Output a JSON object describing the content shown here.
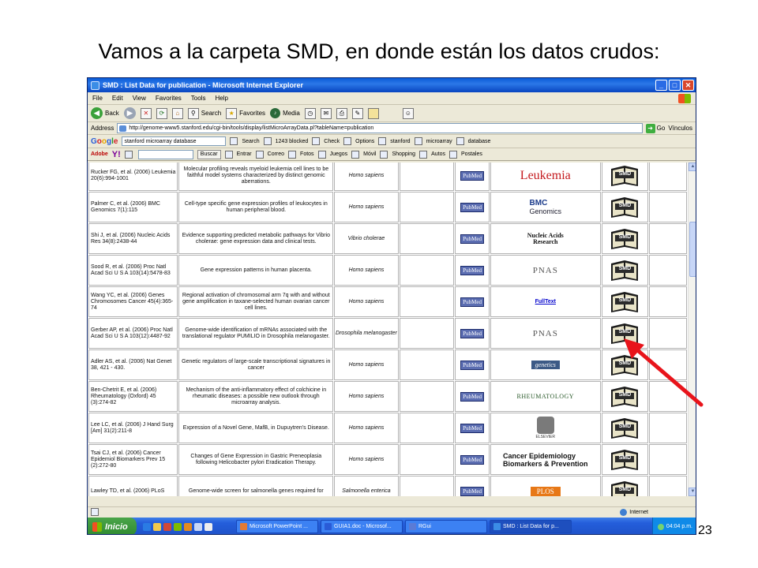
{
  "slide": {
    "title": "Vamos a la carpeta SMD, en donde están los datos crudos:",
    "number": "23"
  },
  "window": {
    "title": "SMD : List Data for publication - Microsoft Internet Explorer",
    "min": "_",
    "max": "□",
    "close": "✕"
  },
  "menu": [
    "File",
    "Edit",
    "View",
    "Favorites",
    "Tools",
    "Help"
  ],
  "toolbar": {
    "back": "Back",
    "search": "Search",
    "favorites": "Favorites",
    "media": "Media"
  },
  "address": {
    "label": "Address",
    "url": "http://genome-www5.stanford.edu/cgi-bin/tools/display/listMicroArrayData.pl?tableName=publication",
    "go": "Go",
    "links": "Vínculos"
  },
  "google": {
    "logo": "Google",
    "query": "stanford microarray database",
    "search": "Search",
    "blocked": "1243 blocked",
    "check": "Check",
    "options": "Options",
    "chips": [
      "stanford",
      "microarray",
      "database"
    ]
  },
  "yahoo": {
    "logo": "Y!",
    "adobe": "Adobe",
    "buscar": "Buscar",
    "entrar": "Entrar",
    "items": [
      "Correo",
      "Fotos",
      "Juegos",
      "Móvil",
      "Shopping",
      "Autos",
      "Postales"
    ]
  },
  "rows": [
    {
      "cite": "Rucker FG, et al. (2006) Leukemia 20(6):994-1001",
      "desc": "Molecular profiling reveals myeloid leukemia cell lines to be faithful model systems characterized by distinct genomic aberrations.",
      "org": "Homo sapiens",
      "pubmed": "PubMed",
      "journal": "Leukemia",
      "journal_style": "leukemia",
      "smd": "SMD"
    },
    {
      "cite": "Palmer C, et al. (2006) BMC Genomics 7(1):115",
      "desc": "Cell-type specific gene expression profiles of leukocytes in human peripheral blood.",
      "org": "Homo sapiens",
      "pubmed": "PubMed",
      "journal": "BMC",
      "journal2": "Genomics",
      "journal_style": "bmc",
      "smd": "SMD"
    },
    {
      "cite": "Shi J, et al. (2006) Nucleic Acids Res 34(8):2438-44",
      "desc": "Evidence supporting predicted metabolic pathways for Vibrio cholerae: gene expression data and clinical tests.",
      "org": "Vibrio cholerae",
      "pubmed": "PubMed",
      "journal": "Nucleic Acids",
      "journal2": "Research",
      "journal_style": "nar",
      "smd": "SMD"
    },
    {
      "cite": "Sood R, et al. (2006) Proc Natl Acad Sci U S A 103(14):5478-83",
      "desc": "Gene expression patterns in human placenta.",
      "org": "Homo sapiens",
      "pubmed": "PubMed",
      "journal": "PNAS",
      "journal_style": "pnas",
      "smd": "SMD"
    },
    {
      "cite": "Wang YC, et al. (2006) Genes Chromosomes Cancer 45(4):365-74",
      "desc": "Regional activation of chromosomal arm 7q with and without gene amplification in taxane-selected human ovarian cancer cell lines.",
      "org": "Homo sapiens",
      "pubmed": "PubMed",
      "journal": "FullText",
      "journal_style": "fulltext",
      "smd": "SMD"
    },
    {
      "cite": "Gerber AP, et al. (2006) Proc Natl Acad Sci U S A 103(12):4487-92",
      "desc": "Genome-wide identification of mRNAs associated with the translational regulator PUMILIO in Drosophila melanogaster.",
      "org": "Drosophila melanogaster",
      "pubmed": "PubMed",
      "journal": "PNAS",
      "journal_style": "pnas",
      "smd": "SMD"
    },
    {
      "cite": "Adler AS, et al. (2006) Nat Genet 38, 421 - 430.",
      "desc": "Genetic regulators of large-scale transcriptional signatures in cancer",
      "org": "Homo sapiens",
      "pubmed": "PubMed",
      "journal": "genetics",
      "journal_style": "genetics",
      "smd": "SMD"
    },
    {
      "cite": "Ben-Chetrit E, et al. (2006) Rheumatology (Oxford) 45 (3):274-82",
      "desc": "Mechanism of the anti-inflammatory effect of colchicine in rheumatic diseases: a possible new outlook through microarray analysis.",
      "org": "Homo sapiens",
      "pubmed": "PubMed",
      "journal": "RHEUMATOLOGY",
      "journal_style": "rheum",
      "smd": "SMD"
    },
    {
      "cite": "Lee LC, et al. (2006) J Hand Surg [Am] 31(2):211-8",
      "desc": "Expression of a Novel Gene, MafB, in Dupuytren's Disease.",
      "org": "Homo sapiens",
      "pubmed": "PubMed",
      "journal": "ELSEVIER",
      "journal_style": "elsevier",
      "smd": "SMD"
    },
    {
      "cite": "Tsai CJ, et al. (2006) Cancer Epidemiol Biomarkers Prev 15 (2):272-80",
      "desc": "Changes of Gene Expression in Gastric Preneoplasia following Helicobacter pylori Eradication Therapy.",
      "org": "Homo sapiens",
      "pubmed": "PubMed",
      "journal": "Cancer Epidemiology",
      "journal2": "Biomarkers & Prevention",
      "journal_style": "cebp",
      "smd": "SMD"
    },
    {
      "cite": "Lawley TD, et al. (2006) PLoS",
      "desc": "Genome-wide screen for salmonella genes required for",
      "org": "Salmonella enterica",
      "pubmed": "PubMed",
      "journal": "PLOS",
      "journal_style": "plos",
      "smd": "SMD"
    }
  ],
  "status": {
    "zone": "Internet"
  },
  "taskbar": {
    "start": "Inicio",
    "tasks": [
      "Microsoft PowerPoint ...",
      "GUIA1.doc - Microsof...",
      "RGui",
      "SMD : List Data for p..."
    ],
    "clock": "04:04 p.m."
  },
  "colors": {
    "arrow": "#e8141b",
    "leukemia": "#c4191d",
    "pubmed_bg": "#5b6db1"
  }
}
